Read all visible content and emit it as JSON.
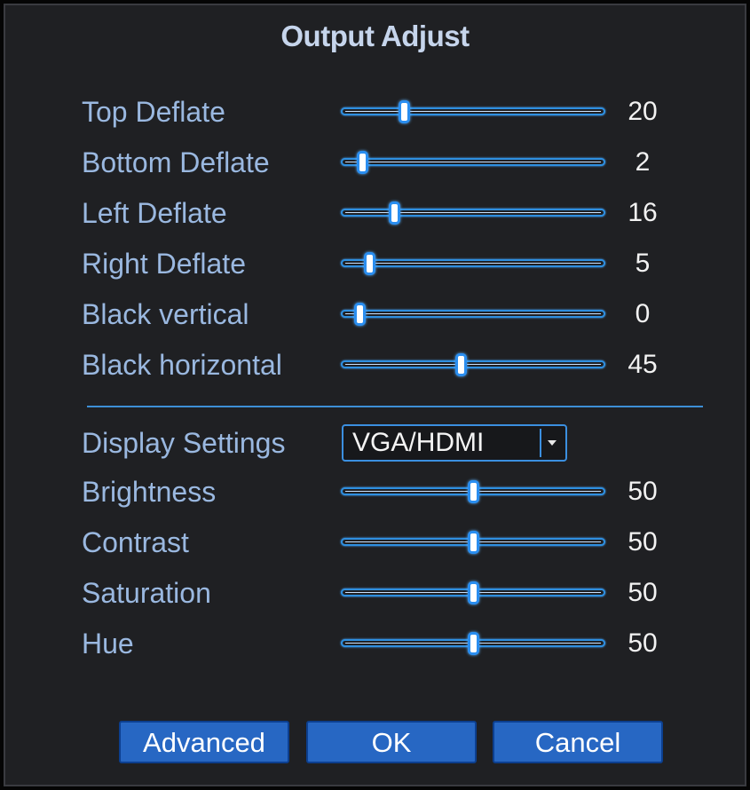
{
  "dialog": {
    "title": "Output Adjust"
  },
  "deflate_rows": [
    {
      "key": "top-deflate",
      "label": "Top Deflate",
      "value": "20",
      "level": 0.22
    },
    {
      "key": "bottom-deflate",
      "label": "Bottom Deflate",
      "value": "2",
      "level": 0.05
    },
    {
      "key": "left-deflate",
      "label": "Left Deflate",
      "value": "16",
      "level": 0.18
    },
    {
      "key": "right-deflate",
      "label": "Right Deflate",
      "value": "5",
      "level": 0.08
    },
    {
      "key": "black-vertical",
      "label": "Black vertical",
      "value": "0",
      "level": 0.04
    },
    {
      "key": "black-horizontal",
      "label": "Black horizontal",
      "value": "45",
      "level": 0.45
    }
  ],
  "display_settings": {
    "label": "Display Settings",
    "selected": "VGA/HDMI",
    "dropdown_icon": "chevron-down-icon"
  },
  "image_rows": [
    {
      "key": "brightness",
      "label": "Brightness",
      "value": "50",
      "level": 0.5
    },
    {
      "key": "contrast",
      "label": "Contrast",
      "value": "50",
      "level": 0.5
    },
    {
      "key": "saturation",
      "label": "Saturation",
      "value": "50",
      "level": 0.5
    },
    {
      "key": "hue",
      "label": "Hue",
      "value": "50",
      "level": 0.5
    }
  ],
  "buttons": {
    "advanced": "Advanced",
    "ok": "OK",
    "cancel": "Cancel"
  },
  "colors": {
    "background": "#1f2023",
    "label": "#9ab8e0",
    "accent": "#2e8fe0",
    "button": "#2767c3"
  }
}
